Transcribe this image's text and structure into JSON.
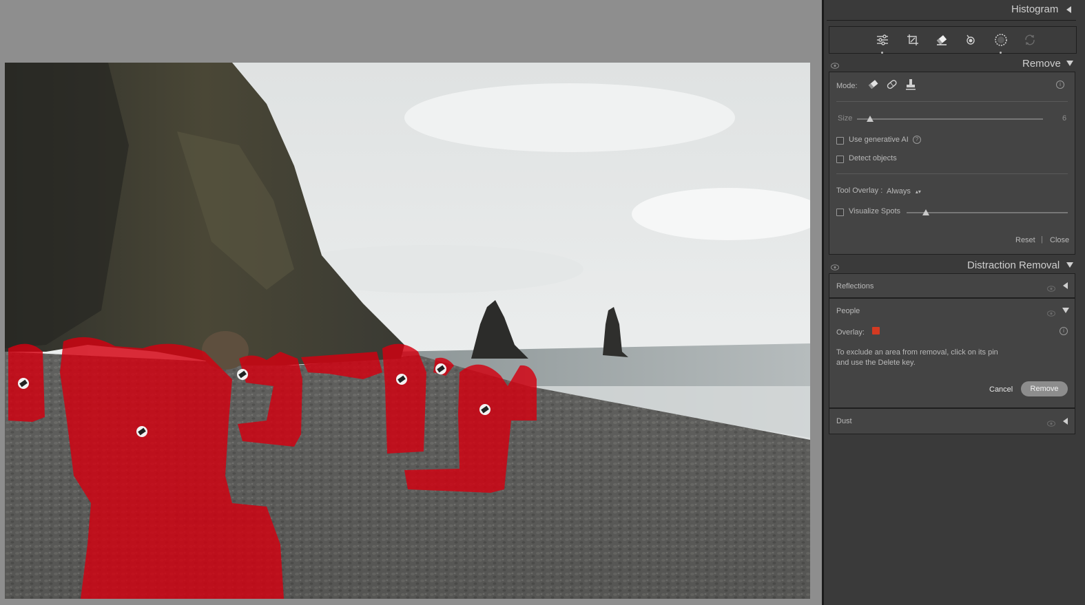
{
  "panel": {
    "histogram_label": "Histogram",
    "remove_section": {
      "title": "Remove",
      "mode_label": "Mode:",
      "size_label": "Size",
      "size_value": "6",
      "size_level": 0.05,
      "use_generative_ai_label": "Use generative AI",
      "detect_objects_label": "Detect objects",
      "tool_overlay_label": "Tool Overlay :",
      "tool_overlay_value": "Always",
      "visualize_spots_label": "Visualize Spots",
      "visualize_spots_level": 0.12,
      "reset_label": "Reset",
      "close_label": "Close"
    },
    "distraction_section": {
      "title": "Distraction Removal",
      "reflections_label": "Reflections",
      "people_label": "People",
      "overlay_label": "Overlay:",
      "overlay_color": "#d33a22",
      "help_text_line1": "To exclude an area from removal, click on its pin",
      "help_text_line2": "and use the Delete key.",
      "cancel_label": "Cancel",
      "remove_label": "Remove",
      "dust_label": "Dust"
    },
    "tools": [
      "edit-sliders-icon",
      "crop-icon",
      "eraser-icon",
      "red-eye-icon",
      "masking-icon",
      "presets-icon"
    ]
  },
  "colors": {
    "mask": "#d40010",
    "panel_bg": "#3a3a3a"
  }
}
